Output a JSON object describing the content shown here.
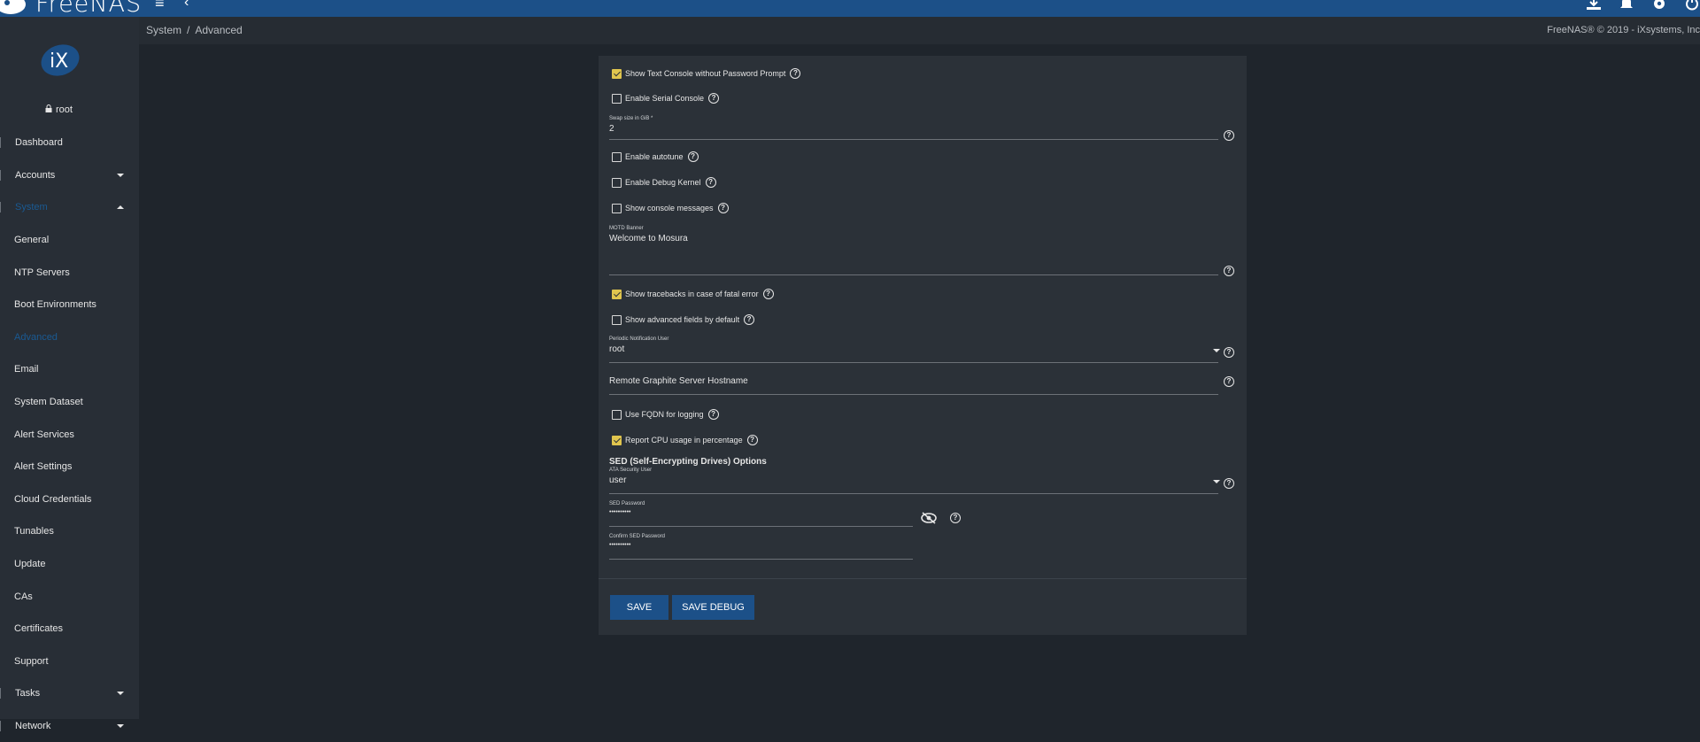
{
  "topbar": {
    "brand": "FreeNAS",
    "icons": [
      "menu-icon",
      "chevron-left-icon",
      "download-icon",
      "bell-icon",
      "gear-icon",
      "power-icon"
    ]
  },
  "sidebar": {
    "user": "root",
    "items": [
      {
        "label": "Dashboard",
        "type": "top"
      },
      {
        "label": "Accounts",
        "type": "top",
        "caret": "down"
      },
      {
        "label": "System",
        "type": "top",
        "caret": "up",
        "active": true
      },
      {
        "label": "General",
        "type": "sub"
      },
      {
        "label": "NTP Servers",
        "type": "sub"
      },
      {
        "label": "Boot Environments",
        "type": "sub"
      },
      {
        "label": "Advanced",
        "type": "sub",
        "active": true
      },
      {
        "label": "Email",
        "type": "sub"
      },
      {
        "label": "System Dataset",
        "type": "sub"
      },
      {
        "label": "Alert Services",
        "type": "sub"
      },
      {
        "label": "Alert Settings",
        "type": "sub"
      },
      {
        "label": "Cloud Credentials",
        "type": "sub"
      },
      {
        "label": "Tunables",
        "type": "sub"
      },
      {
        "label": "Update",
        "type": "sub"
      },
      {
        "label": "CAs",
        "type": "sub"
      },
      {
        "label": "Certificates",
        "type": "sub"
      },
      {
        "label": "Support",
        "type": "sub"
      },
      {
        "label": "Tasks",
        "type": "top",
        "caret": "down"
      },
      {
        "label": "Network",
        "type": "top",
        "caret": "down"
      }
    ]
  },
  "breadcrumb": {
    "parent": "System",
    "separator": "/",
    "current": "Advanced"
  },
  "copyright": "FreeNAS® © 2019 - iXsystems, Inc",
  "form": {
    "show_text_console": {
      "label": "Show Text Console without Password Prompt",
      "checked": true
    },
    "serial_console": {
      "label": "Enable Serial Console",
      "checked": false
    },
    "swap": {
      "label": "Swap size in GiB *",
      "value": "2"
    },
    "autotune": {
      "label": "Enable autotune",
      "checked": false
    },
    "debug_kernel": {
      "label": "Enable Debug Kernel",
      "checked": false
    },
    "console_messages": {
      "label": "Show console messages",
      "checked": false
    },
    "motd": {
      "label": "MOTD Banner",
      "value": "Welcome to Mosura"
    },
    "tracebacks": {
      "label": "Show tracebacks in case of fatal error",
      "checked": true
    },
    "advanced_fields": {
      "label": "Show advanced fields by default",
      "checked": false
    },
    "notification_user": {
      "label": "Periodic Notification User",
      "value": "root"
    },
    "graphite": {
      "placeholder": "Remote Graphite Server Hostname"
    },
    "fqdn": {
      "label": "Use FQDN for logging",
      "checked": false
    },
    "cpu_percent": {
      "label": "Report CPU usage in percentage",
      "checked": true
    },
    "sed_title": "SED (Self-Encrypting Drives) Options",
    "ata_user": {
      "label": "ATA Security User",
      "value": "user"
    },
    "sed_password": {
      "label": "SED Password",
      "value": "••••••••••"
    },
    "confirm_sed_password": {
      "label": "Confirm SED Password",
      "value": "••••••••••"
    },
    "save_label": "SAVE",
    "save_debug_label": "SAVE DEBUG"
  },
  "colors": {
    "accent": "#1c5088",
    "check": "#e0c54e",
    "background": "#1f252c",
    "card": "#2b3138",
    "active_nav": "#1a5a93"
  }
}
